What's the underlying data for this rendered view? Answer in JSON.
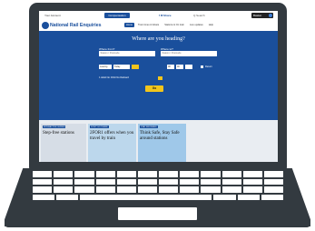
{
  "topbar": {
    "account": "Your Account",
    "cta": "Compensation",
    "social": "f  ✉  Share",
    "search": "Q  Search",
    "basket": "Basket"
  },
  "brand": {
    "logo_text": "National Rail Enquiries"
  },
  "nav": {
    "items": [
      {
        "label": "Home"
      },
      {
        "label": "Train times & tickets"
      },
      {
        "label": "Stations & On train"
      },
      {
        "label": "Live updates"
      },
      {
        "label": "Help"
      }
    ]
  },
  "hero": {
    "heading": "Where are you heading?",
    "from_label": "Where from?",
    "from_placeholder": "Station / Postcode",
    "to_label": "Where to?",
    "to_placeholder": "Station / Postcode",
    "when_leaving": "Leaving",
    "when_day": "Today",
    "hour": "08",
    "minute": "00",
    "return_label": "Return",
    "passengers": "1 Adult  No Child  No Railcard",
    "go_label": "Go"
  },
  "cards": [
    {
      "tag": "INTERACTIVE GUIDES",
      "text": "Step-free stations"
    },
    {
      "tag": "DON'T GO THERE",
      "text": "2FOR1 offers when you travel by train"
    },
    {
      "tag": "STAY INFORMED",
      "text": "Think Safe, Stay Safe around stations"
    }
  ],
  "colors": {
    "brand_blue": "#1a4f9c",
    "go_yellow": "#f2c51c",
    "device_body": "#333a40"
  }
}
